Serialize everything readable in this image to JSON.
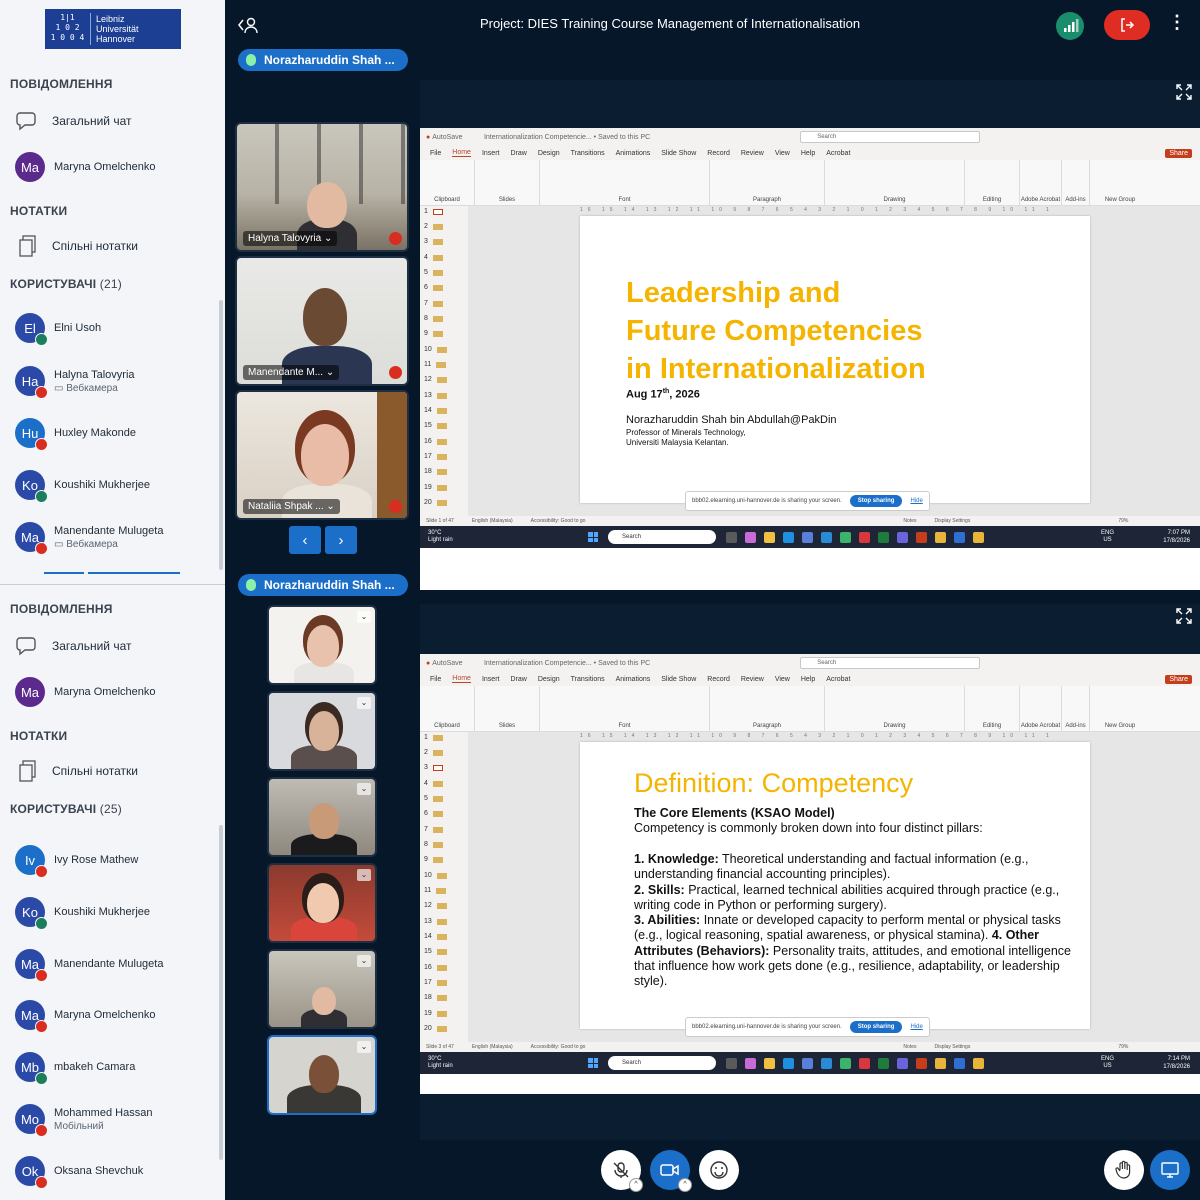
{
  "logo": {
    "mark": "1|1 1\n1 0 2 0\n1 0 0 4",
    "text": "Leibniz\nUniversität\nHannover"
  },
  "sidebar_top": {
    "messages_title": "ПОВІДОМЛЕННЯ",
    "public_chat": "Загальний чат",
    "private_chat_user": {
      "initials": "Ma",
      "name": "Maryna Omelchenko",
      "color": "#5b2a8c"
    },
    "notes_title": "НОТАТКИ",
    "shared_notes": "Спільні нотатки",
    "users_title": "КОРИСТУВАЧІ",
    "users_count": "(21)",
    "users": [
      {
        "initials": "El",
        "name": "Elni Usoh",
        "sub": "",
        "color": "#2b4aa8",
        "mic": "green"
      },
      {
        "initials": "Ha",
        "name": "Halyna Talovyria",
        "sub": "Вебкамера",
        "color": "#2b4aa8",
        "mic": "red"
      },
      {
        "initials": "Hu",
        "name": "Huxley Makonde",
        "sub": "",
        "color": "#1c6fc9",
        "mic": "red"
      },
      {
        "initials": "Ko",
        "name": "Koushiki Mukherjee",
        "sub": "",
        "color": "#2b4aa8",
        "mic": "green"
      },
      {
        "initials": "Ma",
        "name": "Manendante Mulugeta",
        "sub": "Вебкамера",
        "color": "#2b4aa8",
        "mic": "red"
      }
    ]
  },
  "sidebar_bottom": {
    "messages_title": "ПОВІДОМЛЕННЯ",
    "public_chat": "Загальний чат",
    "private_chat_user": {
      "initials": "Ma",
      "name": "Maryna Omelchenko",
      "color": "#5b2a8c"
    },
    "notes_title": "НОТАТКИ",
    "shared_notes": "Спільні нотатки",
    "users_title": "КОРИСТУВАЧІ",
    "users_count": "(25)",
    "users": [
      {
        "initials": "Iv",
        "name": "Ivy Rose Mathew",
        "sub": "",
        "color": "#1c6fc9",
        "mic": "red"
      },
      {
        "initials": "Ko",
        "name": "Koushiki Mukherjee",
        "sub": "",
        "color": "#2b4aa8",
        "mic": "green"
      },
      {
        "initials": "Ma",
        "name": "Manendante Mulugeta",
        "sub": "",
        "color": "#2b4aa8",
        "mic": "red"
      },
      {
        "initials": "Ma",
        "name": "Maryna Omelchenko",
        "sub": "",
        "color": "#2b4aa8",
        "mic": "red"
      },
      {
        "initials": "Mb",
        "name": "mbakeh Camara",
        "sub": "",
        "color": "#2b4aa8",
        "mic": "green"
      },
      {
        "initials": "Mo",
        "name": "Mohammed Hassan",
        "sub": "Мобільний",
        "color": "#2b4aa8",
        "mic": "red"
      },
      {
        "initials": "Ok",
        "name": "Oksana Shevchuk",
        "sub": "",
        "color": "#2b4aa8",
        "mic": "red"
      }
    ]
  },
  "header": {
    "title": "Project: DIES Training Course Management of Internationalisation",
    "leave_icon": "logout-icon",
    "more_icon": "more-vertical-icon"
  },
  "speaker": {
    "name": "Norazharuddin Shah ..."
  },
  "videos_top": [
    {
      "name": "Halyna Talovyria",
      "muted": true
    },
    {
      "name": "Manendante M...",
      "muted": true
    },
    {
      "name": "Nataliia Shpak ...",
      "muted": true
    }
  ],
  "pager": {
    "prev": "‹",
    "next": "›"
  },
  "ppt": {
    "tabs": [
      "File",
      "Home",
      "Insert",
      "Draw",
      "Design",
      "Transitions",
      "Animations",
      "Slide Show",
      "Record",
      "Review",
      "View",
      "Help",
      "Acrobat"
    ],
    "share_label": "Share",
    "search_placeholder": "Search",
    "doc_title": "Internationalization Competencie... • Saved to this PC",
    "autosave": "AutoSave",
    "ribbon_groups": [
      "Clipboard",
      "Slides",
      "Font",
      "Paragraph",
      "Drawing",
      "Editing",
      "Adobe Acrobat",
      "Add-ins",
      "New Group"
    ],
    "ruler": "16 15 14 13 12 11 10 9 8 7 6 5 4 3 2 1 0 1 2 3 4 5 6 7 8 9 10 11 12 13 14 15 16",
    "language": "English (Malaysia)",
    "accessibility": "Accessibility: Good to go",
    "notes": "Notes",
    "display_settings": "Display Settings",
    "zoom": "79%",
    "thumb_numbers": [
      "1",
      "2",
      "3",
      "4",
      "5",
      "6",
      "7",
      "8",
      "9",
      "10",
      "11",
      "12",
      "13",
      "14",
      "15",
      "16",
      "17",
      "18",
      "19",
      "20"
    ]
  },
  "slide1": {
    "title": "Leadership and\nFuture Competencies\nin Internationalization",
    "date_a": "Aug 17",
    "date_sup": "th",
    "date_b": ", 2026",
    "author": "Norazharuddin Shah bin Abdullah@PakDin",
    "role": "Professor of Minerals Technology,",
    "org": "Universiti Malaysia Kelantan.",
    "slide_counter": "Slide 1 of 47",
    "clock_time": "7:07 PM",
    "clock_date": "17/8/2026"
  },
  "slide2": {
    "title": "Definition: Competency",
    "heading": "The Core Elements (KSAO Model)",
    "intro": "Competency is commonly broken down into four distinct pillars:",
    "k_label": "1. Knowledge:",
    "k_text": " Theoretical understanding and factual information (e.g., understanding financial accounting principles).",
    "s_label": "2. Skills:",
    "s_text": " Practical, learned technical abilities acquired through practice (e.g., writing code in Python or performing surgery).",
    "a_label": "3. Abilities:",
    "a_text": " Innate or developed capacity to perform mental or physical tasks (e.g., logical reasoning, spatial awareness, or physical stamina).",
    "o_label": " 4. Other Attributes (Behaviors):",
    "o_text": " Personality traits, attitudes, and emotional intelligence that influence how work gets done (e.g., resilience, adaptability, or leadership style).",
    "slide_counter": "Slide 3 of 47",
    "clock_time": "7:14 PM",
    "clock_date": "17/8/2026"
  },
  "share_banner": {
    "text": "bbb02.elearning.uni-hannover.de is sharing your screen.",
    "stop": "Stop sharing",
    "hide": "Hide"
  },
  "taskbar": {
    "temp": "30°C",
    "weather": "Light rain",
    "search": "Search",
    "lang_a": "ENG",
    "lang_b": "US"
  },
  "controls": {
    "mic_icon": "microphone-muted-icon",
    "camera_icon": "camera-icon",
    "reactions_icon": "smiley-icon",
    "raise_hand_icon": "hand-icon",
    "screenshare_icon": "screen-share-icon"
  }
}
